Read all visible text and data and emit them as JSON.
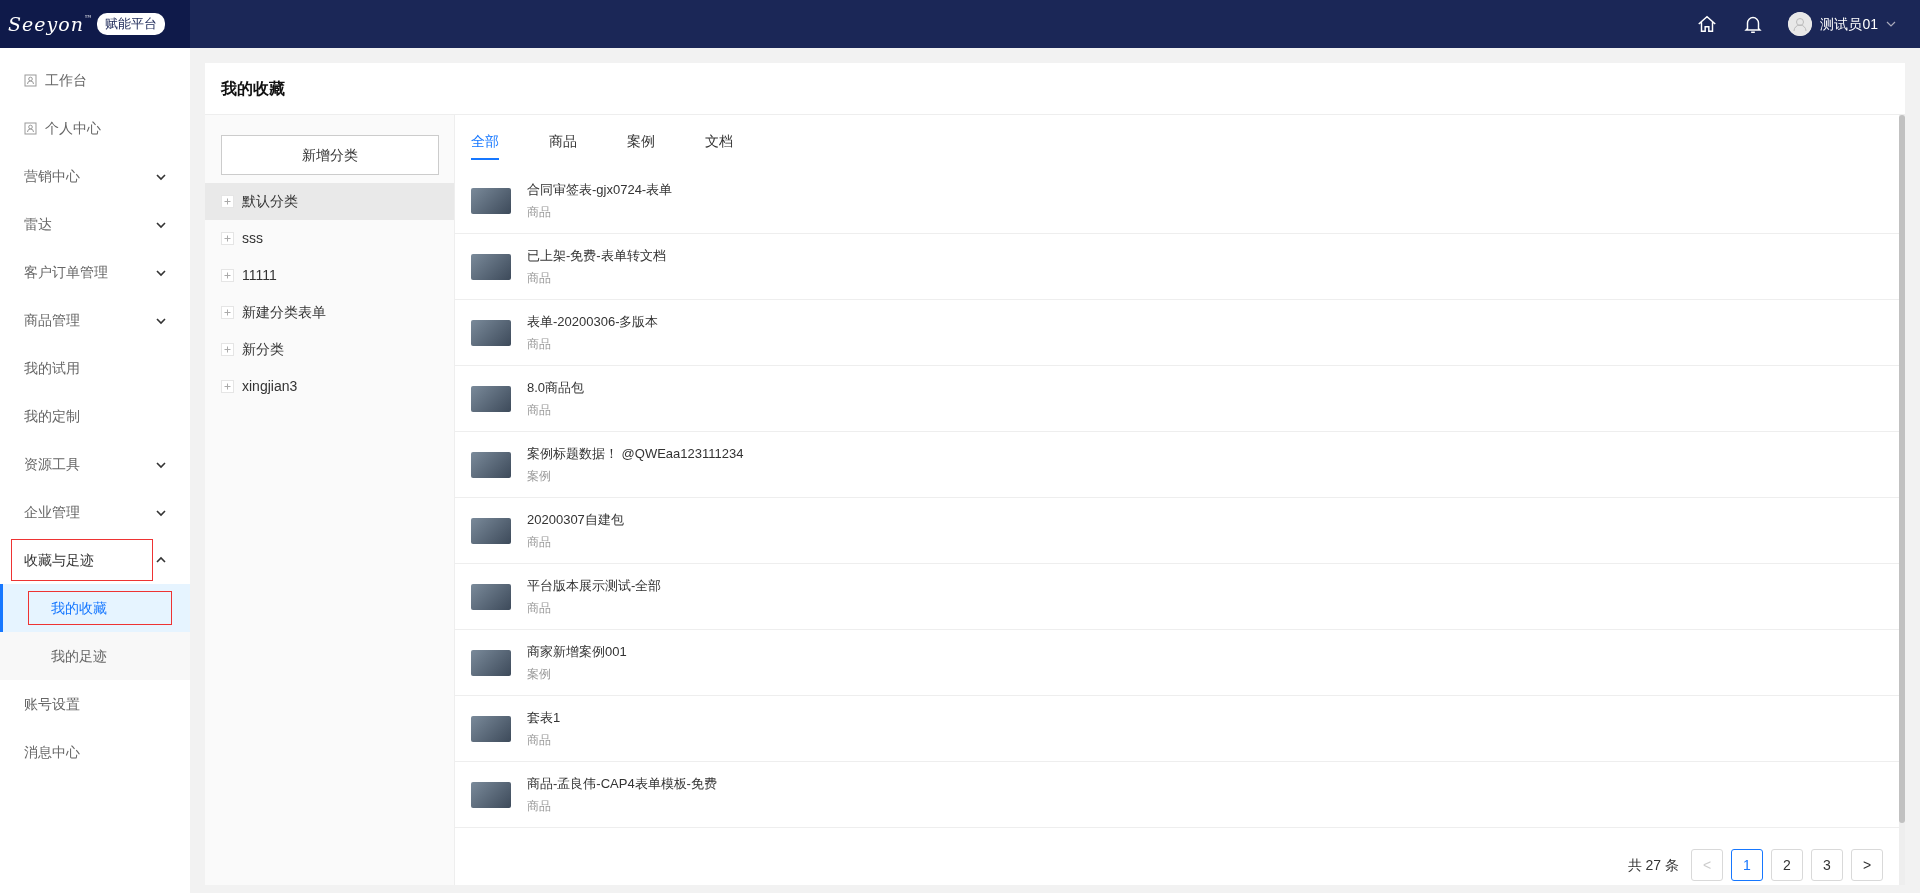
{
  "header": {
    "logo": {
      "text": "Seeyon",
      "mark": "™",
      "badge": "赋能平台"
    },
    "user": {
      "name": "测试员01"
    }
  },
  "sidebar": {
    "items": [
      {
        "label": "工作台",
        "kind": "icon",
        "selected": false,
        "highlighted": false
      },
      {
        "label": "个人中心",
        "kind": "icon",
        "selected": false,
        "highlighted": false
      },
      {
        "label": "营销中心",
        "kind": "group",
        "expanded": false,
        "selected": false,
        "highlighted": false
      },
      {
        "label": "雷达",
        "kind": "group",
        "expanded": false,
        "selected": false,
        "highlighted": false
      },
      {
        "label": "客户订单管理",
        "kind": "group",
        "expanded": false,
        "selected": false,
        "highlighted": false
      },
      {
        "label": "商品管理",
        "kind": "group",
        "expanded": false,
        "selected": false,
        "highlighted": false
      },
      {
        "label": "我的试用",
        "kind": "plain",
        "selected": false,
        "highlighted": false
      },
      {
        "label": "我的定制",
        "kind": "plain",
        "selected": false,
        "highlighted": false
      },
      {
        "label": "资源工具",
        "kind": "group",
        "expanded": false,
        "selected": false,
        "highlighted": false
      },
      {
        "label": "企业管理",
        "kind": "group",
        "expanded": false,
        "selected": false,
        "highlighted": false
      },
      {
        "label": "收藏与足迹",
        "kind": "group",
        "expanded": true,
        "selected": false,
        "highlighted": true,
        "children": [
          {
            "label": "我的收藏",
            "selected": true,
            "highlighted": true
          },
          {
            "label": "我的足迹",
            "selected": false,
            "highlighted": false
          }
        ]
      },
      {
        "label": "账号设置",
        "kind": "plain",
        "selected": false,
        "highlighted": false
      },
      {
        "label": "消息中心",
        "kind": "plain",
        "selected": false,
        "highlighted": false
      }
    ]
  },
  "page": {
    "title": "我的收藏",
    "categories": {
      "add_button": "新增分类",
      "items": [
        {
          "label": "默认分类",
          "selected": true
        },
        {
          "label": "sss",
          "selected": false
        },
        {
          "label": "11111",
          "selected": false
        },
        {
          "label": "新建分类表单",
          "selected": false
        },
        {
          "label": "新分类",
          "selected": false
        },
        {
          "label": "xingjian3",
          "selected": false
        }
      ]
    },
    "tabs": [
      {
        "label": "全部",
        "selected": true
      },
      {
        "label": "商品",
        "selected": false
      },
      {
        "label": "案例",
        "selected": false
      },
      {
        "label": "文档",
        "selected": false
      }
    ],
    "items": [
      {
        "title": "合同审签表-gjx0724-表单",
        "type": "商品"
      },
      {
        "title": "已上架-免费-表单转文档",
        "type": "商品"
      },
      {
        "title": "表单-20200306-多版本",
        "type": "商品"
      },
      {
        "title": "8.0商品包",
        "type": "商品"
      },
      {
        "title": "案例标题数据！ @QWEaa123111234",
        "type": "案例"
      },
      {
        "title": "20200307自建包",
        "type": "商品"
      },
      {
        "title": "平台版本展示测试-全部",
        "type": "商品"
      },
      {
        "title": "商家新增案例001",
        "type": "案例"
      },
      {
        "title": "套表1",
        "type": "商品"
      },
      {
        "title": "商品-孟良伟-CAP4表单模板-免费",
        "type": "商品"
      }
    ],
    "pagination": {
      "total": "共 27 条",
      "prev": "<",
      "next": ">",
      "pages": [
        {
          "label": "1",
          "selected": true
        },
        {
          "label": "2",
          "selected": false
        },
        {
          "label": "3",
          "selected": false
        }
      ]
    }
  }
}
